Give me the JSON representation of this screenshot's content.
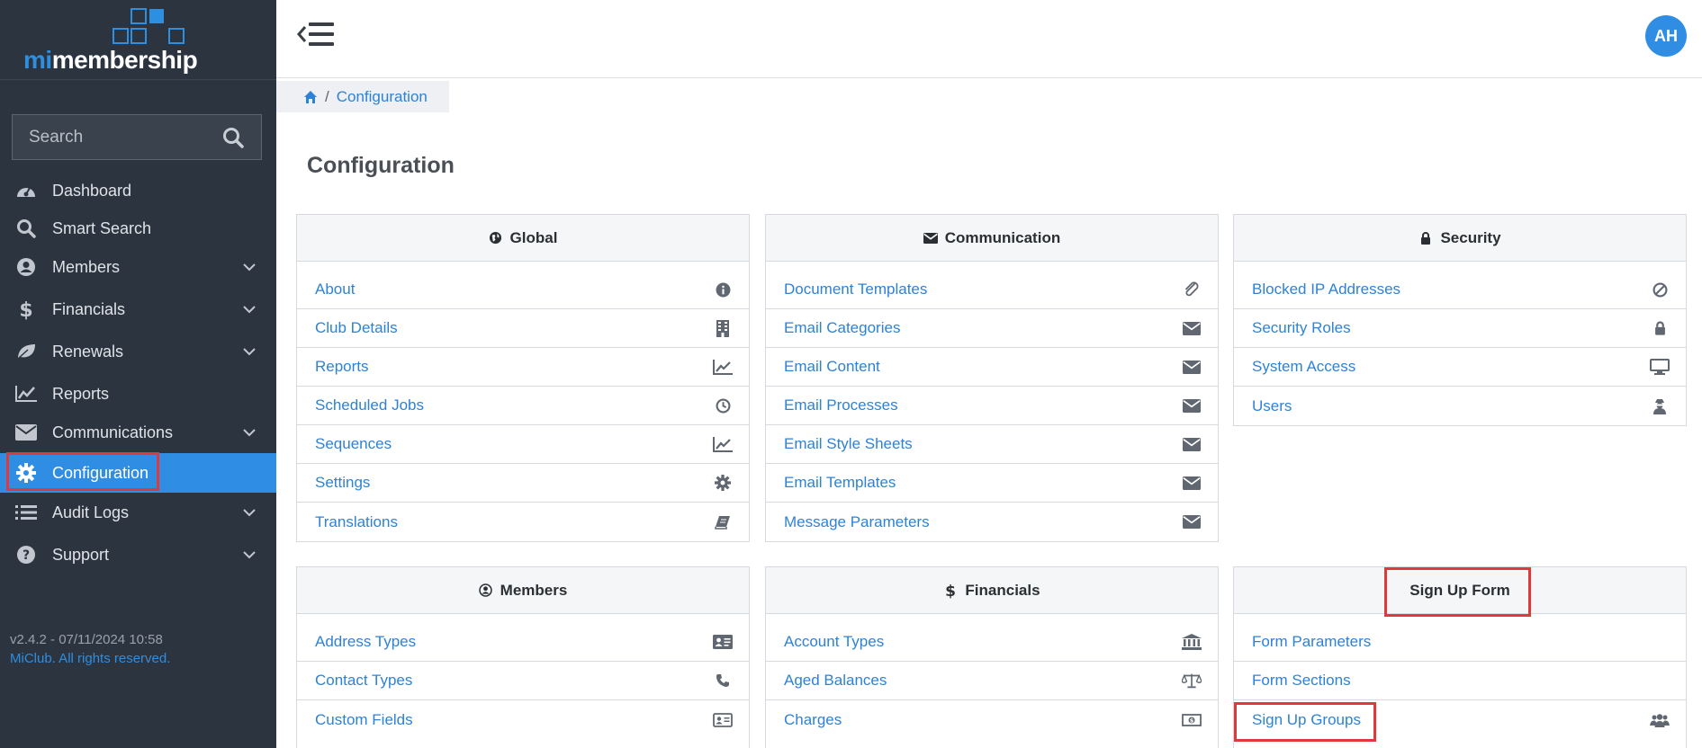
{
  "app": {
    "logo_mi": "mi",
    "logo_rest": "membership",
    "search_placeholder": "Search",
    "version": "v2.4.2 - 07/11/2024 10:58",
    "copyright": "MiClub. All rights reserved.",
    "user_initials": "AH",
    "accent_color": "#2f8de4",
    "sidebar_color": "#2c3440",
    "highlight_color": "#e0393c"
  },
  "sidebar": {
    "items": [
      {
        "label": "Dashboard",
        "icon": "dashboard-icon",
        "has_children": false
      },
      {
        "label": "Smart Search",
        "icon": "search-icon",
        "has_children": false
      },
      {
        "label": "Members",
        "icon": "user-circle-icon",
        "has_children": true
      },
      {
        "label": "Financials",
        "icon": "dollar-icon",
        "has_children": true
      },
      {
        "label": "Renewals",
        "icon": "leaf-icon",
        "has_children": true
      },
      {
        "label": "Reports",
        "icon": "line-chart-icon",
        "has_children": false
      },
      {
        "label": "Communications",
        "icon": "envelope-icon",
        "has_children": true
      },
      {
        "label": "Configuration",
        "icon": "gear-icon",
        "has_children": false,
        "active": true
      },
      {
        "label": "Audit Logs",
        "icon": "list-icon",
        "has_children": true
      },
      {
        "label": "Support",
        "icon": "question-circle-icon",
        "has_children": true
      }
    ]
  },
  "breadcrumb": {
    "separator": "/",
    "current": "Configuration"
  },
  "page": {
    "title": "Configuration"
  },
  "panels": {
    "global": {
      "title": "Global",
      "icon": "globe-icon",
      "rows": [
        {
          "label": "About",
          "icon": "info-circle-icon"
        },
        {
          "label": "Club Details",
          "icon": "building-icon"
        },
        {
          "label": "Reports",
          "icon": "line-chart-icon"
        },
        {
          "label": "Scheduled Jobs",
          "icon": "clock-icon"
        },
        {
          "label": "Sequences",
          "icon": "line-chart-icon"
        },
        {
          "label": "Settings",
          "icon": "gear-icon"
        },
        {
          "label": "Translations",
          "icon": "book-icon"
        }
      ]
    },
    "communication": {
      "title": "Communication",
      "icon": "envelope-icon",
      "rows": [
        {
          "label": "Document Templates",
          "icon": "paperclip-icon"
        },
        {
          "label": "Email Categories",
          "icon": "envelope-icon"
        },
        {
          "label": "Email Content",
          "icon": "envelope-icon"
        },
        {
          "label": "Email Processes",
          "icon": "envelope-icon"
        },
        {
          "label": "Email Style Sheets",
          "icon": "envelope-icon"
        },
        {
          "label": "Email Templates",
          "icon": "envelope-icon"
        },
        {
          "label": "Message Parameters",
          "icon": "envelope-icon"
        }
      ]
    },
    "security": {
      "title": "Security",
      "icon": "lock-icon",
      "rows": [
        {
          "label": "Blocked IP Addresses",
          "icon": "ban-icon"
        },
        {
          "label": "Security Roles",
          "icon": "lock-icon"
        },
        {
          "label": "System Access",
          "icon": "desktop-icon"
        },
        {
          "label": "Users",
          "icon": "user-secret-icon"
        }
      ]
    },
    "members": {
      "title": "Members",
      "icon": "user-circle-icon",
      "rows": [
        {
          "label": "Address Types",
          "icon": "address-card-icon"
        },
        {
          "label": "Contact Types",
          "icon": "phone-icon"
        },
        {
          "label": "Custom Fields",
          "icon": "id-card-icon"
        }
      ]
    },
    "financials": {
      "title": "Financials",
      "icon": "dollar-icon",
      "rows": [
        {
          "label": "Account Types",
          "icon": "bank-icon"
        },
        {
          "label": "Aged Balances",
          "icon": "balance-scale-icon"
        },
        {
          "label": "Charges",
          "icon": "money-icon"
        }
      ]
    },
    "signup": {
      "title": "Sign Up Form",
      "rows": [
        {
          "label": "Form Parameters",
          "icon": ""
        },
        {
          "label": "Form Sections",
          "icon": ""
        },
        {
          "label": "Sign Up Groups",
          "icon": "users-icon"
        }
      ]
    }
  }
}
